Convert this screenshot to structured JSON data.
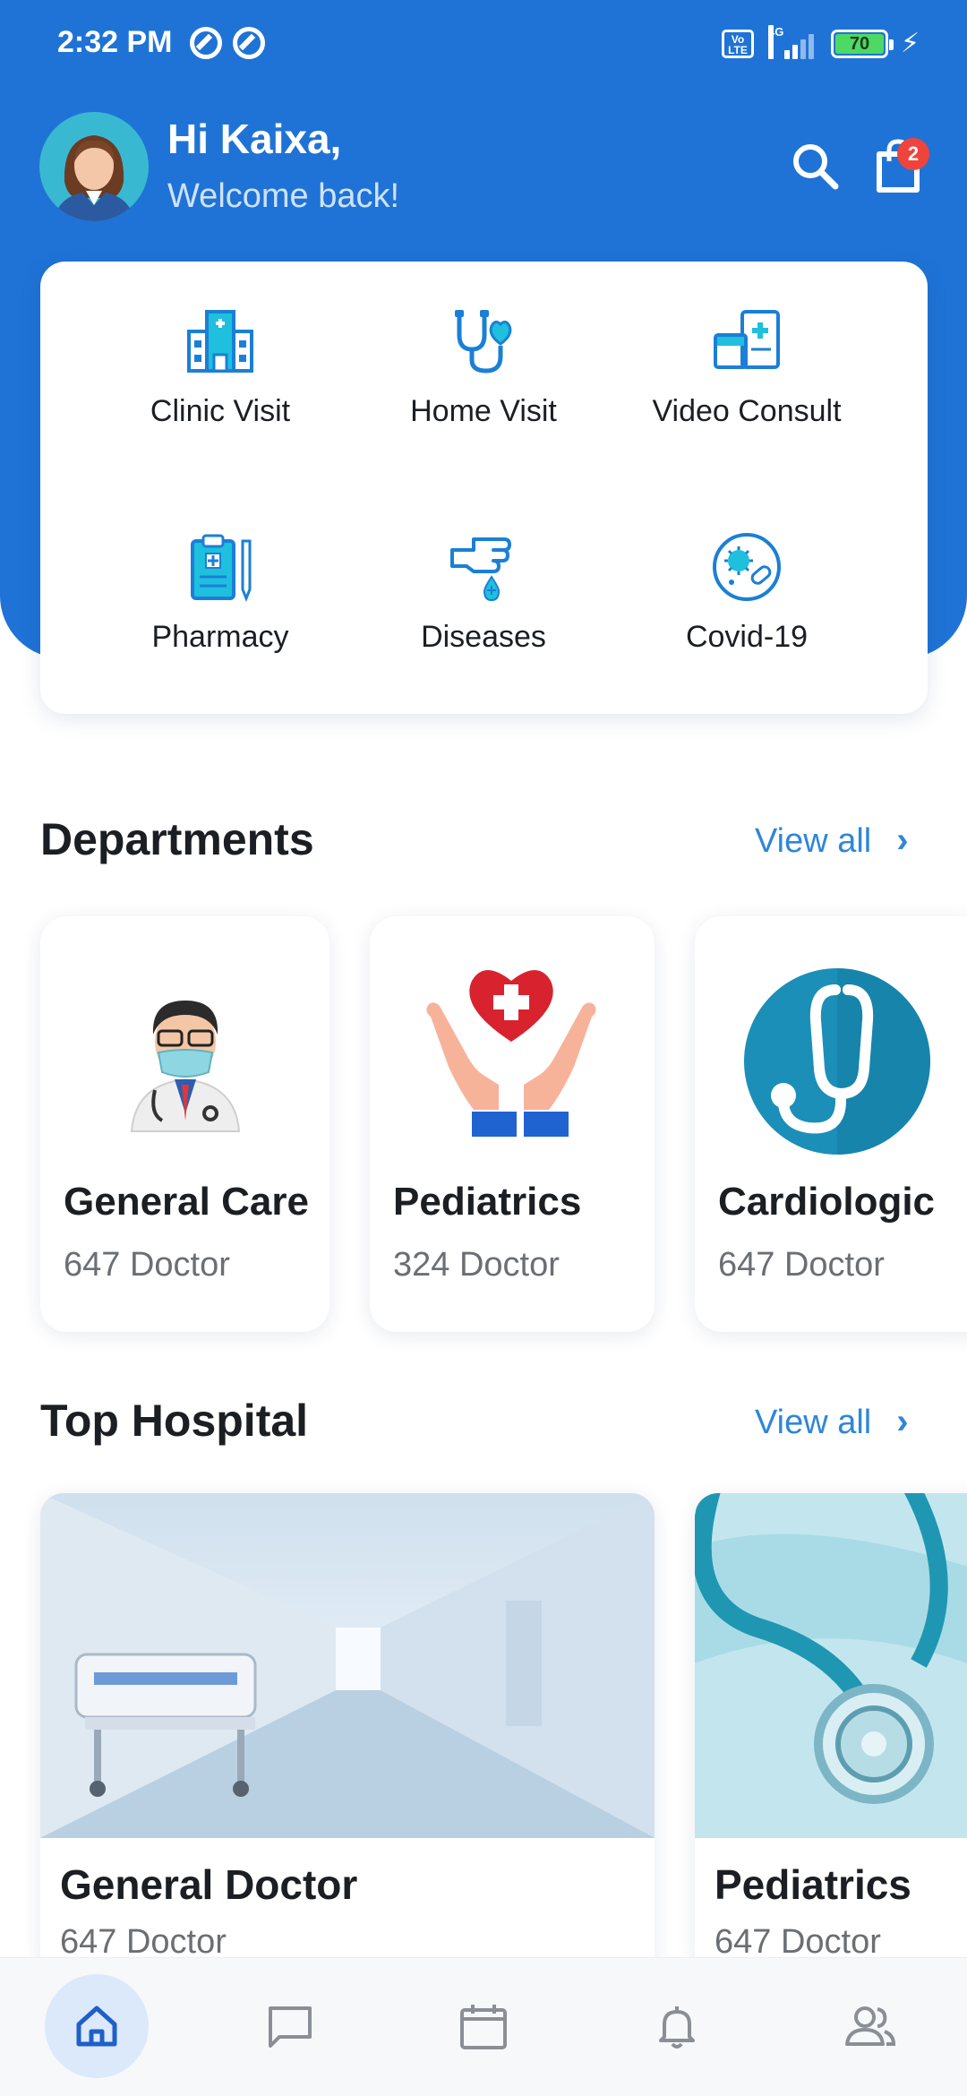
{
  "status_bar": {
    "time": "2:32 PM",
    "volte": "Vo LTE",
    "network": "4G",
    "battery": "70"
  },
  "header": {
    "greeting": "Hi Kaixa,",
    "subtitle": "Welcome back!",
    "cart_count": "2",
    "search_icon": "search-icon",
    "cart_icon": "shopping-bag-icon"
  },
  "services": [
    {
      "label": "Clinic Visit",
      "icon": "hospital-building-icon"
    },
    {
      "label": "Home Visit",
      "icon": "stethoscope-heart-icon"
    },
    {
      "label": "Video Consult",
      "icon": "medical-screen-icon"
    },
    {
      "label": "Pharmacy",
      "icon": "clipboard-icon"
    },
    {
      "label": "Diseases",
      "icon": "hand-drop-icon"
    },
    {
      "label": "Covid-19",
      "icon": "virus-icon"
    }
  ],
  "departments": {
    "title": "Departments",
    "view_all": "View all",
    "items": [
      {
        "name": "General Care",
        "count": "647 Doctor"
      },
      {
        "name": "Pediatrics",
        "count": "324 Doctor"
      },
      {
        "name": "Cardiologic",
        "count": "647 Doctor"
      }
    ]
  },
  "hospitals": {
    "title": "Top Hospital",
    "view_all": "View all",
    "items": [
      {
        "name": "General Doctor",
        "count": "647 Doctor"
      },
      {
        "name": "Pediatrics",
        "count": "647 Doctor"
      }
    ]
  },
  "bottom_nav": [
    {
      "icon": "home-icon",
      "active": true
    },
    {
      "icon": "chat-icon",
      "active": false
    },
    {
      "icon": "calendar-icon",
      "active": false
    },
    {
      "icon": "bell-icon",
      "active": false
    },
    {
      "icon": "users-icon",
      "active": false
    }
  ],
  "colors": {
    "primary": "#1f73d6",
    "accent": "#2f86d8",
    "badge": "#f0433c",
    "cyan": "#1fbfde"
  }
}
